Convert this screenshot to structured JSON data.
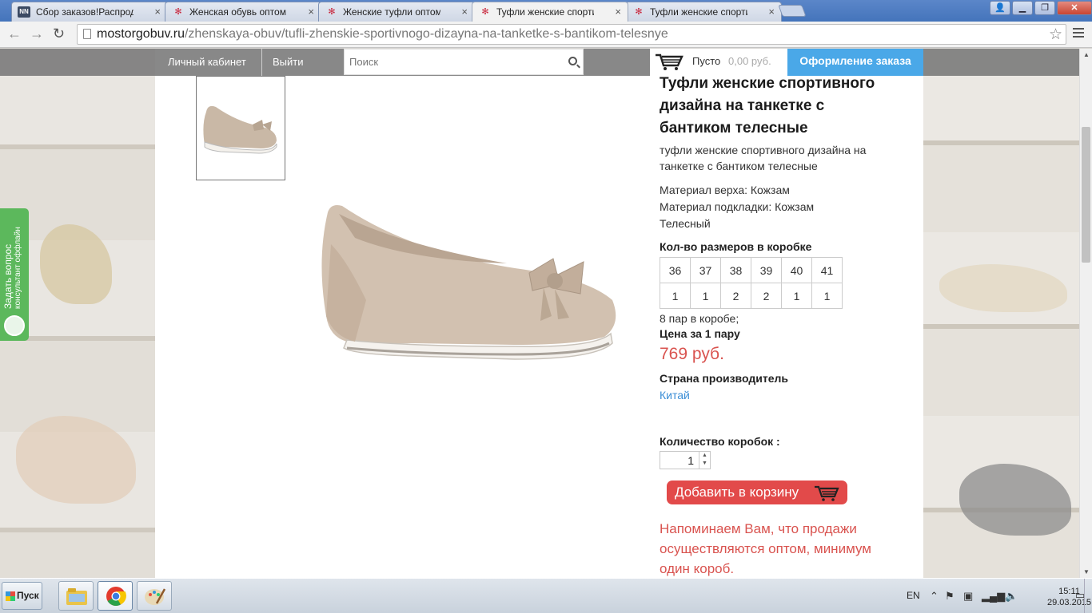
{
  "browser": {
    "tabs": [
      {
        "title": "Сбор заказов!Распродажа д",
        "favicon": "NN",
        "active": false
      },
      {
        "title": "Женская обувь оптом. Куп",
        "favicon": "✻",
        "active": false
      },
      {
        "title": "Женские туфли оптом | Ве",
        "favicon": "✻",
        "active": false
      },
      {
        "title": "Туфли женские спортивног",
        "favicon": "✻",
        "active": true
      },
      {
        "title": "Туфли женские спортивног",
        "favicon": "✻",
        "active": false
      }
    ],
    "url_domain": "mostorgobuv.ru",
    "url_path": "/zhenskaya-obuv/tufli-zhenskie-sportivnogo-dizayna-na-tanketke-s-bantikom-telesnye"
  },
  "site": {
    "account_link": "Личный кабинет",
    "logout_link": "Выйти",
    "search_placeholder": "Поиск",
    "cart_status": "Пусто",
    "cart_total": "0,00 руб.",
    "checkout_button": "Оформление заказа"
  },
  "side_widget": {
    "line1": "Задать вопрос",
    "line2": "консультант оффлайн"
  },
  "product": {
    "title": "Туфли женские спортивного дизайна на танкетке с бантиком телесные",
    "subtitle": "туфли женские спортивного дизайна на танкетке с бантиком телесные",
    "material_top": "Материал верха: Кожзам",
    "material_lining": "Материал подкладки: Кожзам",
    "color": "Телесный",
    "sizes_heading": "Кол-во размеров в коробке",
    "sizes": [
      "36",
      "37",
      "38",
      "39",
      "40",
      "41"
    ],
    "counts": [
      "1",
      "1",
      "2",
      "2",
      "1",
      "1"
    ],
    "pairs_in_box": "8 пар в коробе;",
    "price_heading": "Цена за 1 пару",
    "price": "769 руб.",
    "country_heading": "Страна производитель",
    "country": "Китай",
    "quantity_label": "Количество коробок :",
    "quantity_value": "1",
    "add_to_cart": "Добавить в корзину",
    "notice": "Напоминаем Вам, что продажи осуществляются оптом, минимум один короб."
  },
  "taskbar": {
    "start_label": "Пуск",
    "language": "EN",
    "time": "15:11",
    "date": "29.03.2015"
  }
}
